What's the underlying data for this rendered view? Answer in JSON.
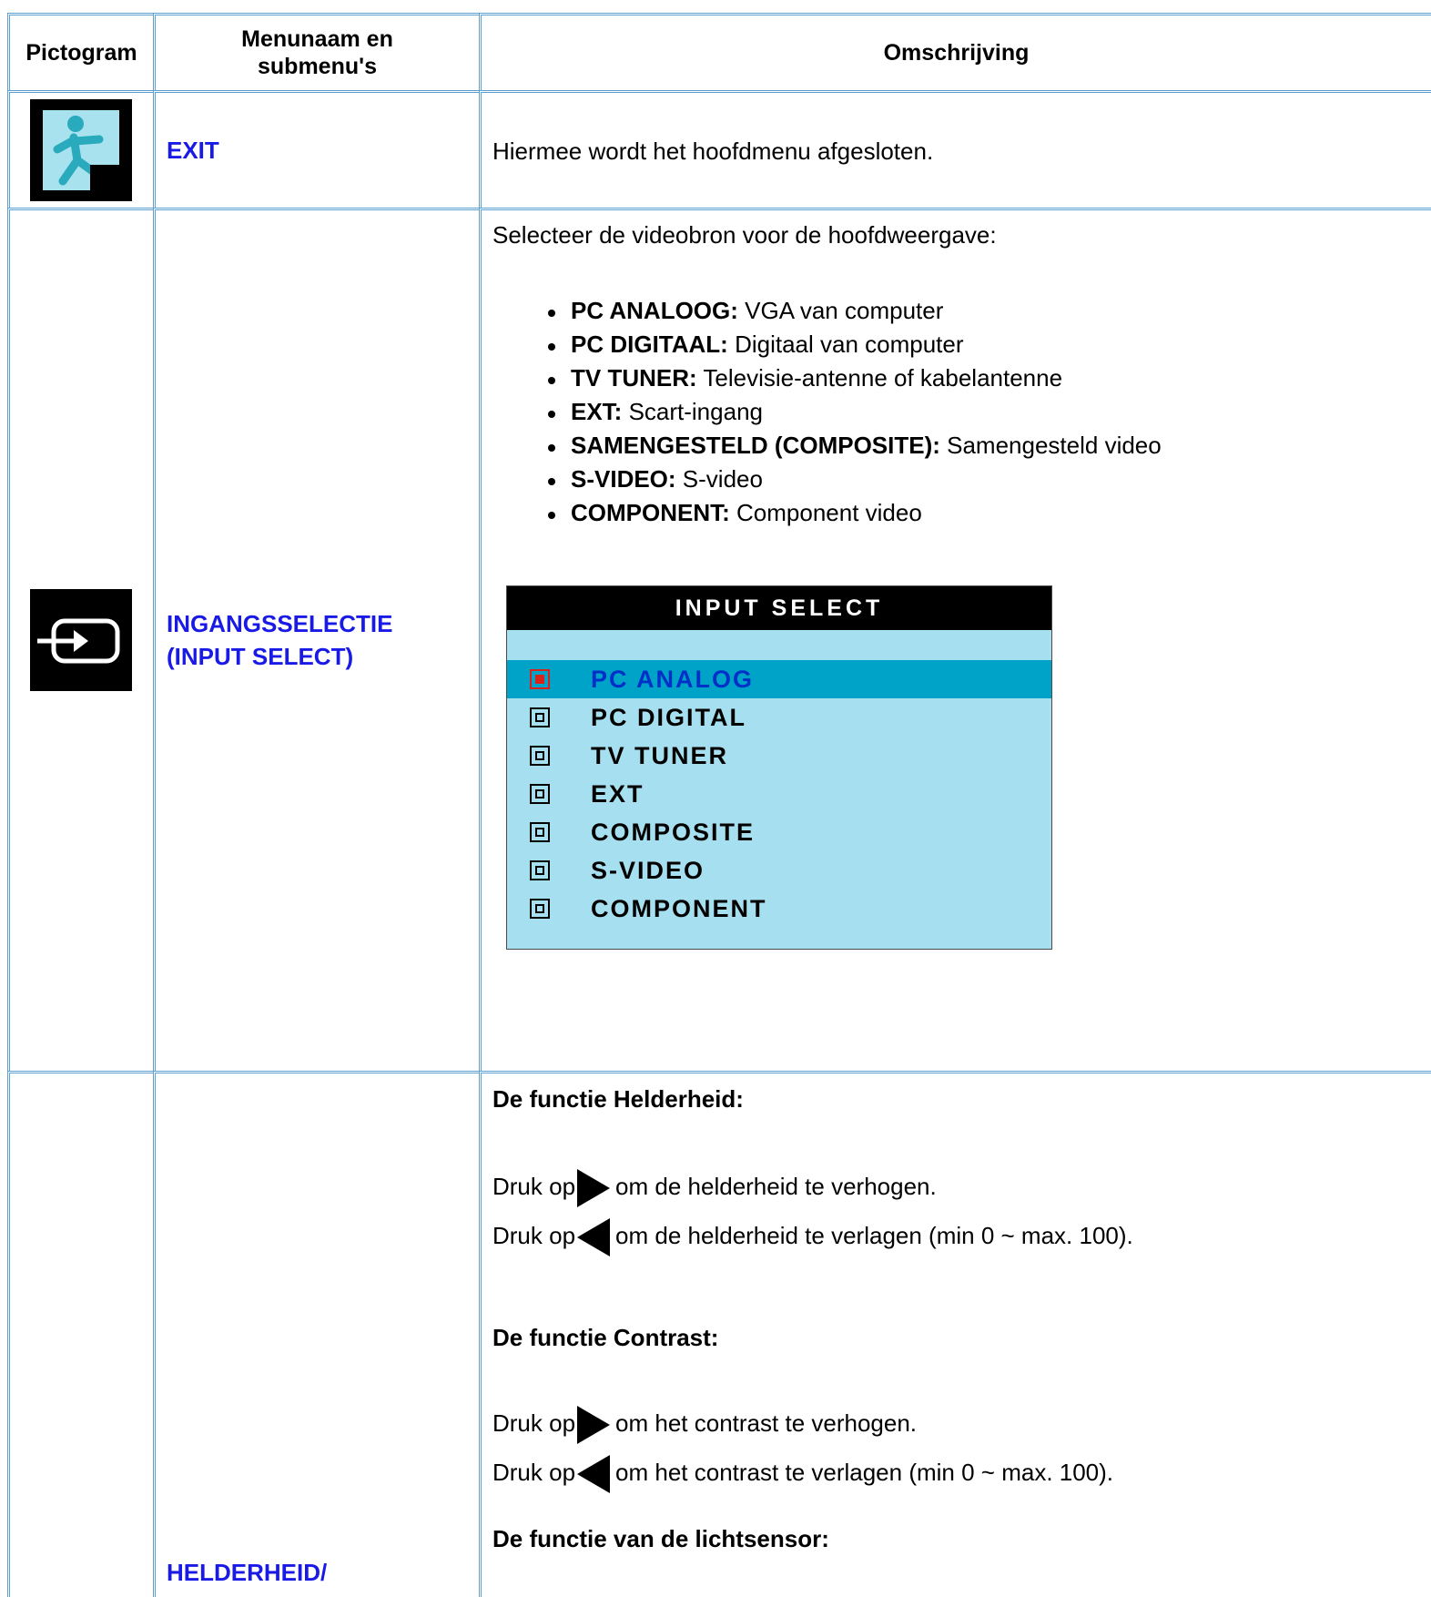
{
  "header": {
    "col1": "Pictogram",
    "col2": "Menunaam en submenu's",
    "col3": "Omschrijving"
  },
  "rows": {
    "exit": {
      "icon": "exit-running-man-icon",
      "name": "EXIT",
      "description": "Hiermee wordt het hoofdmenu afgesloten."
    },
    "input": {
      "icon": "input-select-icon",
      "name_line1": "INGANGSSELECTIE",
      "name_line2": "(INPUT SELECT)",
      "intro": "Selecteer de videobron voor de hoofdweergave:",
      "sources": [
        {
          "term": "PC ANALOOG:",
          "text": " VGA van computer"
        },
        {
          "term": "PC DIGITAAL:",
          "text": " Digitaal van computer"
        },
        {
          "term": "TV TUNER:",
          "text": " Televisie-antenne of kabelantenne"
        },
        {
          "term": "EXT:",
          "text": " Scart-ingang"
        },
        {
          "term": "SAMENGESTELD (COMPOSITE):",
          "text": " Samengesteld video"
        },
        {
          "term": "S-VIDEO:",
          "text": " S-video"
        },
        {
          "term": "COMPONENT:",
          "text": " Component video"
        }
      ],
      "osd": {
        "title": "INPUT SELECT",
        "items": [
          "PC ANALOG",
          "PC DIGITAL",
          "TV TUNER",
          "EXT",
          "COMPOSITE",
          "S-VIDEO",
          "COMPONENT"
        ],
        "selected_index": 0,
        "colors": {
          "title_bg": "#000000",
          "panel_bg": "#a6dff0",
          "highlight": "#00a3c8",
          "selected_box": "#d8231a",
          "selected_text": "#0030c8"
        }
      }
    },
    "brightness": {
      "name": "HELDERHEID/",
      "brightness_heading": "De functie Helderheid:",
      "druk_op": "Druk op",
      "b_up": "om de helderheid te verhogen.",
      "b_down": "om de helderheid te verlagen (min 0 ~ max. 100).",
      "contrast_heading": "De functie Contrast:",
      "c_up": "om het contrast te verhogen.",
      "c_down": "om het contrast te verlagen (min 0 ~ max. 100).",
      "sensor_heading": "De functie van de lichtsensor:"
    }
  },
  "colors": {
    "border": "#5a9fd0",
    "link": "#1a1ae6"
  }
}
